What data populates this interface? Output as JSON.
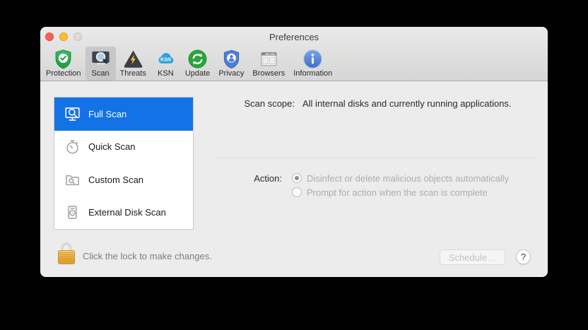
{
  "window": {
    "title": "Preferences"
  },
  "toolbar": {
    "items": [
      {
        "label": "Protection",
        "selected": false
      },
      {
        "label": "Scan",
        "selected": true
      },
      {
        "label": "Threats",
        "selected": false
      },
      {
        "label": "KSN",
        "selected": false,
        "icon_text": "KSN"
      },
      {
        "label": "Update",
        "selected": false
      },
      {
        "label": "Privacy",
        "selected": false
      },
      {
        "label": "Browsers",
        "selected": false
      },
      {
        "label": "Information",
        "selected": false
      }
    ]
  },
  "sidebar": {
    "items": [
      {
        "label": "Full Scan",
        "selected": true
      },
      {
        "label": "Quick Scan",
        "selected": false
      },
      {
        "label": "Custom Scan",
        "selected": false
      },
      {
        "label": "External Disk Scan",
        "selected": false
      }
    ]
  },
  "content": {
    "scan_scope_label": "Scan scope:",
    "scan_scope_value": "All internal disks and currently running applications.",
    "action_label": "Action:",
    "action_options": [
      {
        "label": "Disinfect or delete malicious objects automatically",
        "selected": true
      },
      {
        "label": "Prompt for action when the scan is complete",
        "selected": false
      }
    ]
  },
  "footer": {
    "lock_text": "Click the lock to make changes.",
    "schedule_label": "Schedule…",
    "help_label": "?"
  },
  "colors": {
    "selection_blue": "#1373E6",
    "window_bg": "#ECECEC",
    "toolbar_selected_bg": "#C7C7C7",
    "shield_green": "#27A63C",
    "threat_yellow": "#FFC820",
    "ksn_cloud_blue": "#2FA3DC",
    "privacy_blue": "#4D7FD6",
    "info_blue": "#4A82D9",
    "lock_gold": "#EFAF3C",
    "traffic_red": "#FC5E55",
    "traffic_yellow": "#FDBC2F"
  }
}
